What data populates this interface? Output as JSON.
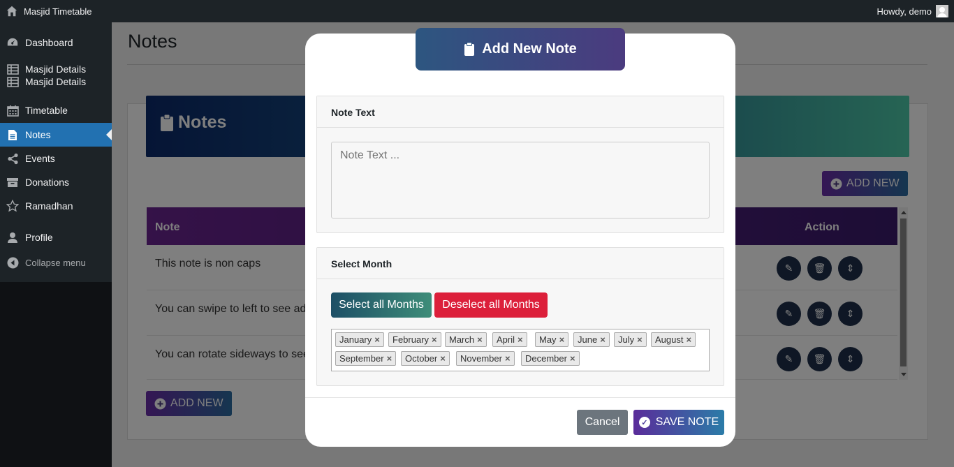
{
  "adminbar": {
    "site_title": "Masjid Timetable",
    "howdy": "Howdy, demo"
  },
  "sidebar": {
    "items": [
      {
        "label": "Dashboard",
        "icon": "dashboard-icon"
      },
      {
        "label": "Masjid Details",
        "icon": "table-icon"
      },
      {
        "label": "Masjid Details",
        "icon": "table-icon"
      },
      {
        "label": "Timetable",
        "icon": "calendar-icon"
      },
      {
        "label": "Notes",
        "icon": "document-icon",
        "active": true
      },
      {
        "label": "Events",
        "icon": "share-icon"
      },
      {
        "label": "Donations",
        "icon": "archive-icon"
      },
      {
        "label": "Ramadhan",
        "icon": "star-icon"
      },
      {
        "label": "Profile",
        "icon": "user-icon"
      }
    ],
    "collapse": "Collapse menu"
  },
  "page": {
    "title": "Notes",
    "hero_title": "Notes",
    "add_new": "ADD NEW",
    "table": {
      "headers": [
        "Note",
        "Action"
      ],
      "rows": [
        "This note is non caps",
        "You can swipe to left to see ad",
        "You can rotate sideways to see"
      ]
    }
  },
  "modal": {
    "title": "Add New Note",
    "note_panel_title": "Note Text",
    "note_placeholder": "Note Text ...",
    "month_panel_title": "Select Month",
    "select_all": "Select all Months",
    "deselect_all": "Deselect all Months",
    "months": [
      "January",
      "February",
      "March",
      "April",
      "May",
      "June",
      "July",
      "August",
      "September",
      "October",
      "November",
      "December"
    ],
    "cancel": "Cancel",
    "save": "SAVE NOTE"
  },
  "colors": {
    "accent": "#2271b1",
    "select_all": "#1e5f6b",
    "deselect_all": "#dc3545",
    "cancel": "#6c757d"
  }
}
